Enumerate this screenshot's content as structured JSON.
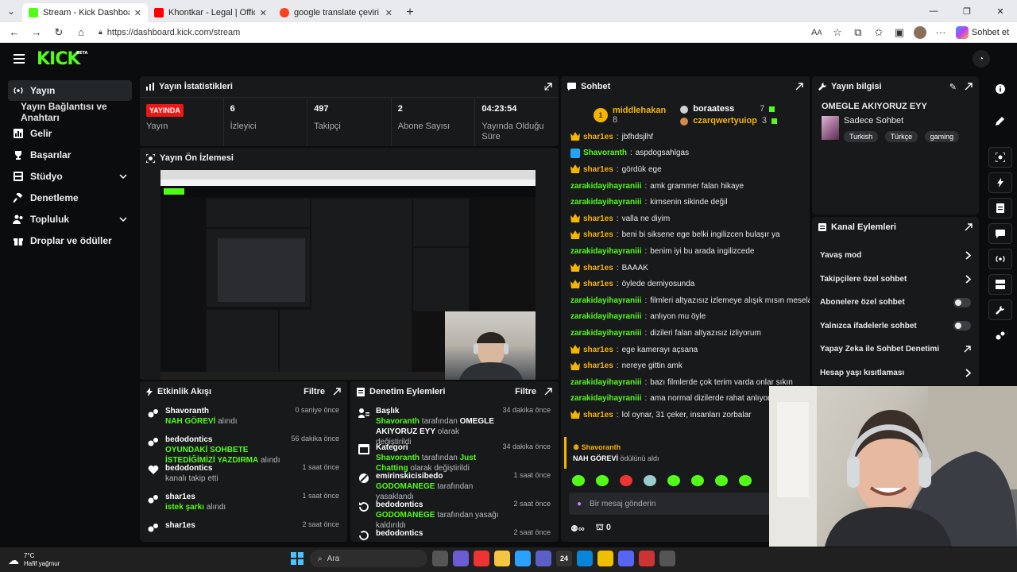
{
  "browser": {
    "tabs": [
      {
        "title": "Stream - Kick Dashboard",
        "color": "#53fc18",
        "active": true
      },
      {
        "title": "Khontkar - Legal | Official Video -",
        "color": "#ff0000",
        "active": false
      },
      {
        "title": "google translate çeviri — Yandex:",
        "color": "#fc3f1d",
        "active": false
      }
    ],
    "url": "https://dashboard.kick.com/stream",
    "copilot_label": "Sohbet et"
  },
  "app": {
    "logo": "KICK",
    "logo_sup": "BETA"
  },
  "sidebar": {
    "items": [
      {
        "label": "Yayın",
        "icon": "broadcast-icon"
      },
      {
        "label": "Yayın Bağlantısı ve Anahtarı",
        "icon": ""
      },
      {
        "label": "Gelir",
        "icon": "chart-icon"
      },
      {
        "label": "Başarılar",
        "icon": "trophy-icon"
      },
      {
        "label": "Stüdyo",
        "icon": "film-icon"
      },
      {
        "label": "Denetleme",
        "icon": "hammer-icon"
      },
      {
        "label": "Topluluk",
        "icon": "people-icon"
      },
      {
        "label": "Droplar ve ödüller",
        "icon": "gift-icon"
      }
    ]
  },
  "stats": {
    "title": "Yayın İstatistikleri",
    "live_badge": "YAYINDA",
    "items": [
      {
        "value": "",
        "label": "Yayın"
      },
      {
        "value": "6",
        "label": "İzleyici"
      },
      {
        "value": "497",
        "label": "Takipçi"
      },
      {
        "value": "2",
        "label": "Abone Sayısı"
      },
      {
        "value": "04:23:54",
        "label": "Yayında Olduğu Süre"
      }
    ]
  },
  "preview": {
    "title": "Yayın Ön İzlemesi"
  },
  "activity": {
    "title": "Etkinlik Akışı",
    "filter": "Filtre",
    "rows": [
      {
        "name": "Shavoranth",
        "time": "0 saniye önce",
        "g": "NAH GÖREVİ",
        "rest": " alındı"
      },
      {
        "name": "bedodontics",
        "time": "56 dakika önce",
        "g": "OYUNDAKİ SOHBETE İSTEDİĞİMİZİ YAZDIRMA",
        "rest": " alındı"
      },
      {
        "name": "bedodontics",
        "time": "1 saat önce",
        "g": "",
        "rest": "kanalı takip etti"
      },
      {
        "name": "shar1es",
        "time": "1 saat önce",
        "g": "istek şarkı",
        "rest": " alındı"
      },
      {
        "name": "shar1es",
        "time": "2 saat önce",
        "g": "",
        "rest": ""
      }
    ]
  },
  "moderation": {
    "title": "Denetim Eylemleri",
    "filter": "Filtre",
    "rows": [
      {
        "name": "Başlık",
        "time": "34 dakika önce",
        "g": "Shavoranth",
        "mid": " tarafından ",
        "w": "OMEGLE AKIYORUZ EYY",
        "rest": " olarak değiştirildi"
      },
      {
        "name": "Kategori",
        "time": "34 dakika önce",
        "g": "Shavoranth",
        "mid": " tarafından ",
        "w": "Just Chatting",
        "rest": " olarak değiştirildi"
      },
      {
        "name": "emirinskicisibedo",
        "time": "1 saat önce",
        "g": "GODOMANEGE",
        "mid": " tarafından yasaklandı",
        "w": "",
        "rest": ""
      },
      {
        "name": "bedodontics",
        "time": "2 saat önce",
        "g": "GODOMANEGE",
        "mid": " tarafından yasağı kaldırıldı",
        "w": "",
        "rest": ""
      },
      {
        "name": "bedodontics",
        "time": "2 saat önce",
        "g": "",
        "mid": "",
        "w": "",
        "rest": ""
      }
    ]
  },
  "chat": {
    "title": "Sohbet",
    "top_gifters": [
      {
        "name": "middlehakan",
        "count": "8"
      },
      {
        "name": "boraatess",
        "count": "7"
      },
      {
        "name": "czarqwertyuiop",
        "count": "3"
      }
    ],
    "messages": [
      {
        "user": "shar1es",
        "color": "#f5b400",
        "badge": "crown",
        "text": "jbfhdsjlhf"
      },
      {
        "user": "Shavoranth",
        "color": "#53fc18",
        "badge": "blue",
        "text": "aspdogsahlgas"
      },
      {
        "user": "shar1es",
        "color": "#f5b400",
        "badge": "crown",
        "text": "gördük ege"
      },
      {
        "user": "zarakidayihayraniii",
        "color": "#53fc18",
        "badge": "",
        "text": "amk grammer falan hikaye"
      },
      {
        "user": "zarakidayihayraniii",
        "color": "#53fc18",
        "badge": "",
        "text": "kimsenin sikinde değil"
      },
      {
        "user": "shar1es",
        "color": "#f5b400",
        "badge": "crown",
        "text": "valla ne diyim"
      },
      {
        "user": "shar1es",
        "color": "#f5b400",
        "badge": "crown",
        "text": "beni bi siksene ege belki ingilizcen bulaşır ya"
      },
      {
        "user": "zarakidayihayraniii",
        "color": "#53fc18",
        "badge": "",
        "text": "benim iyi bu arada ingilizcede"
      },
      {
        "user": "shar1es",
        "color": "#f5b400",
        "badge": "crown",
        "text": "BAAAK"
      },
      {
        "user": "shar1es",
        "color": "#f5b400",
        "badge": "crown",
        "text": "öylede demiyosunda"
      },
      {
        "user": "zarakidayihayraniii",
        "color": "#53fc18",
        "badge": "",
        "text": "filmleri altyazısız izlemeye alışık mısın mesela"
      },
      {
        "user": "zarakidayihayraniii",
        "color": "#53fc18",
        "badge": "",
        "text": "anlıyon mu öyle"
      },
      {
        "user": "zarakidayihayraniii",
        "color": "#53fc18",
        "badge": "",
        "text": "dizileri falan altyazısız izliyorum"
      },
      {
        "user": "shar1es",
        "color": "#f5b400",
        "badge": "crown",
        "text": "ege kamerayı açsana"
      },
      {
        "user": "shar1es",
        "color": "#f5b400",
        "badge": "crown",
        "text": "nereye gittin amk"
      },
      {
        "user": "zarakidayihayraniii",
        "color": "#53fc18",
        "badge": "",
        "text": "bazı filmlerde çok terim varda onlar sıkın"
      },
      {
        "user": "zarakidayihayraniii",
        "color": "#53fc18",
        "badge": "",
        "text": "ama normal dizilerde rahat anlıyom"
      },
      {
        "user": "shar1es",
        "color": "#f5b400",
        "badge": "crown",
        "text": "lol oynar, 31 çeker, insanları zorbalar"
      }
    ],
    "redeem": {
      "user": "Shavoranth",
      "reward": "NAH GÖREVİ",
      "suffix": " ödülünü aldı"
    },
    "input_placeholder": "Bir mesaj gönderin",
    "points": "0"
  },
  "stream_info": {
    "title": "Yayın bilgisi",
    "stream_title": "OMEGLE AKIYORUZ EYY",
    "category": "Sadece Sohbet",
    "tags": [
      "Turkish",
      "Türkçe",
      "gaming"
    ]
  },
  "channel_actions": {
    "title": "Kanal Eylemleri",
    "items": [
      {
        "label": "Yavaş mod",
        "control": "chevron"
      },
      {
        "label": "Takipçilere özel sohbet",
        "control": "chevron"
      },
      {
        "label": "Abonelere özel sohbet",
        "control": "toggle"
      },
      {
        "label": "Yalnızca ifadelerle sohbet",
        "control": "toggle"
      },
      {
        "label": "Yapay Zeka ile Sohbet Denetimi",
        "control": "external"
      },
      {
        "label": "Hesap yaşı kısıtlaması",
        "control": "chevron"
      }
    ]
  },
  "taskbar": {
    "temp": "7°C",
    "weather": "Hafif yağmur",
    "search_placeholder": "Ara",
    "badge_24": "24"
  }
}
